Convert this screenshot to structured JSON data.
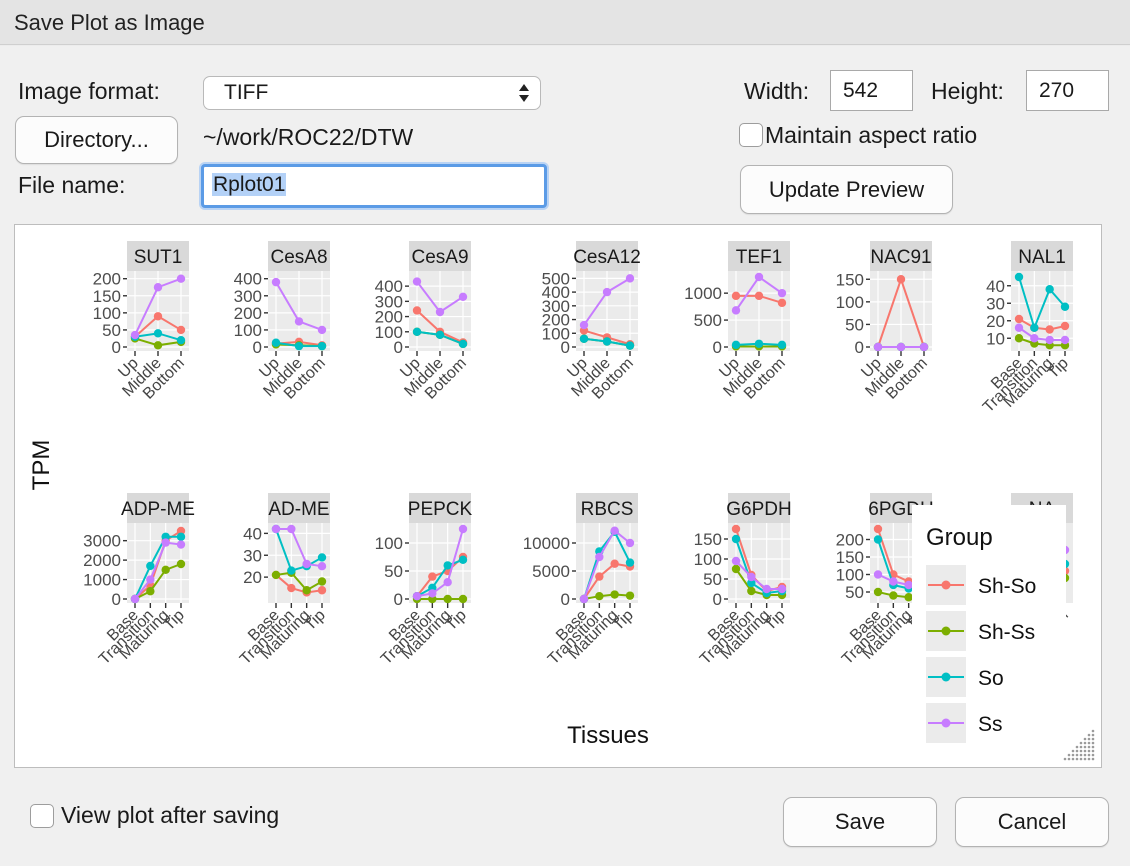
{
  "window": {
    "title": "Save Plot as Image"
  },
  "form": {
    "image_format_label": "Image format:",
    "image_format_value": "TIFF",
    "directory_button": "Directory...",
    "directory_path": "~/work/ROC22/DTW",
    "file_name_label": "File name:",
    "file_name_value": "Rplot01",
    "width_label": "Width:",
    "width_value": "542",
    "height_label": "Height:",
    "height_value": "270",
    "maintain_aspect_label": "Maintain aspect ratio",
    "maintain_aspect_checked": false,
    "update_preview_button": "Update Preview",
    "view_after_saving_label": "View plot after saving",
    "view_after_saving_checked": false,
    "save_button": "Save",
    "cancel_button": "Cancel"
  },
  "chart_data": {
    "type": "line",
    "xlabel": "Tissues",
    "ylabel": "TPM",
    "legend": {
      "title": "Group",
      "position": "right",
      "entries": [
        {
          "name": "Sh-So",
          "color": "#F8766D"
        },
        {
          "name": "Sh-Ss",
          "color": "#7CAE00"
        },
        {
          "name": "So",
          "color": "#00BFC4"
        },
        {
          "name": "Ss",
          "color": "#C77CFF"
        }
      ]
    },
    "panels": [
      {
        "title": "SUT1",
        "x": [
          "Up",
          "Middle",
          "Bottom"
        ],
        "yticks": [
          0,
          50,
          100,
          150,
          200
        ],
        "ylim": [
          0,
          205
        ],
        "series": {
          "Sh-So": [
            30,
            90,
            50
          ],
          "Sh-Ss": [
            25,
            5,
            15
          ],
          "So": [
            30,
            40,
            20
          ],
          "Ss": [
            35,
            175,
            200
          ]
        }
      },
      {
        "title": "CesA8",
        "x": [
          "Up",
          "Middle",
          "Bottom"
        ],
        "yticks": [
          0,
          100,
          200,
          300,
          400
        ],
        "ylim": [
          0,
          410
        ],
        "series": {
          "Sh-So": [
            20,
            30,
            10
          ],
          "Sh-Ss": [
            15,
            10,
            5
          ],
          "So": [
            25,
            5,
            5
          ],
          "Ss": [
            380,
            150,
            100
          ]
        }
      },
      {
        "title": "CesA9",
        "x": [
          "Up",
          "Middle",
          "Bottom"
        ],
        "yticks": [
          0,
          100,
          200,
          300,
          400
        ],
        "ylim": [
          0,
          460
        ],
        "series": {
          "Sh-So": [
            240,
            100,
            30
          ],
          "Sh-Ss": [
            100,
            80,
            20
          ],
          "So": [
            100,
            80,
            20
          ],
          "Ss": [
            430,
            230,
            330
          ]
        }
      },
      {
        "title": "CesA12",
        "x": [
          "Up",
          "Middle",
          "Bottom"
        ],
        "yticks": [
          0,
          100,
          200,
          300,
          400,
          500
        ],
        "ylim": [
          0,
          510
        ],
        "series": {
          "Sh-So": [
            120,
            70,
            20
          ],
          "Sh-Ss": [
            60,
            40,
            10
          ],
          "So": [
            60,
            40,
            10
          ],
          "Ss": [
            160,
            400,
            500
          ]
        }
      },
      {
        "title": "TEF1",
        "x": [
          "Up",
          "Middle",
          "Bottom"
        ],
        "yticks": [
          0,
          500,
          1000
        ],
        "ylim": [
          0,
          1300
        ],
        "series": {
          "Sh-So": [
            950,
            950,
            820
          ],
          "Sh-Ss": [
            10,
            10,
            10
          ],
          "So": [
            40,
            60,
            40
          ],
          "Ss": [
            680,
            1300,
            1000
          ]
        }
      },
      {
        "title": "NAC91",
        "x": [
          "Up",
          "Middle",
          "Bottom"
        ],
        "yticks": [
          0,
          50,
          100,
          150
        ],
        "ylim": [
          0,
          155
        ],
        "series": {
          "Sh-So": [
            0,
            150,
            0
          ],
          "Sh-Ss": [
            0,
            0,
            0
          ],
          "So": [
            0,
            0,
            0
          ],
          "Ss": [
            0,
            0,
            0
          ]
        }
      },
      {
        "title": "NAL1",
        "x": [
          "Base",
          "Transition",
          "Maturing",
          "Tip"
        ],
        "yticks": [
          10,
          20,
          30,
          40
        ],
        "ylim": [
          5,
          45
        ],
        "series": {
          "Sh-So": [
            21,
            16,
            15,
            17
          ],
          "Sh-Ss": [
            10,
            7,
            6,
            6
          ],
          "So": [
            45,
            16,
            38,
            28
          ],
          "Ss": [
            16,
            10,
            9,
            9
          ]
        }
      },
      {
        "title": "ADP-ME",
        "x": [
          "Base",
          "Transition",
          "Maturing",
          "Tip"
        ],
        "yticks": [
          0,
          1000,
          2000,
          3000
        ],
        "ylim": [
          0,
          3600
        ],
        "series": {
          "Sh-So": [
            0,
            700,
            3000,
            3500
          ],
          "Sh-Ss": [
            0,
            400,
            1500,
            1800
          ],
          "So": [
            0,
            1700,
            3200,
            3200
          ],
          "Ss": [
            0,
            1000,
            2900,
            2800
          ]
        }
      },
      {
        "title": "AD-ME",
        "x": [
          "Base",
          "Transition",
          "Maturing",
          "Tip"
        ],
        "yticks": [
          20,
          30,
          40
        ],
        "ylim": [
          10,
          42
        ],
        "series": {
          "Sh-So": [
            21,
            15,
            13,
            14
          ],
          "Sh-Ss": [
            21,
            22,
            14,
            18
          ],
          "So": [
            42,
            23,
            25,
            29
          ],
          "Ss": [
            42,
            42,
            26,
            25
          ]
        }
      },
      {
        "title": "PEPCK",
        "x": [
          "Base",
          "Transition",
          "Maturing",
          "Tip"
        ],
        "yticks": [
          0,
          50,
          100
        ],
        "ylim": [
          0,
          125
        ],
        "series": {
          "Sh-So": [
            5,
            40,
            50,
            75
          ],
          "Sh-Ss": [
            0,
            0,
            0,
            0
          ],
          "So": [
            5,
            20,
            60,
            70
          ],
          "Ss": [
            5,
            10,
            30,
            125
          ]
        }
      },
      {
        "title": "RBCS",
        "x": [
          "Base",
          "Transition",
          "Maturing",
          "Tip"
        ],
        "yticks": [
          0,
          5000,
          10000
        ],
        "ylim": [
          0,
          12500
        ],
        "series": {
          "Sh-So": [
            0,
            4000,
            6300,
            5800
          ],
          "Sh-Ss": [
            0,
            500,
            800,
            600
          ],
          "So": [
            0,
            8500,
            12000,
            6500
          ],
          "Ss": [
            0,
            7500,
            12200,
            10000
          ]
        }
      },
      {
        "title": "G6PDH",
        "x": [
          "Base",
          "Transition",
          "Maturing",
          "Tip"
        ],
        "yticks": [
          0,
          50,
          100,
          150
        ],
        "ylim": [
          0,
          175
        ],
        "series": {
          "Sh-So": [
            175,
            60,
            20,
            30
          ],
          "Sh-Ss": [
            75,
            20,
            10,
            10
          ],
          "So": [
            150,
            40,
            15,
            20
          ],
          "Ss": [
            95,
            55,
            25,
            25
          ]
        }
      },
      {
        "title": "6PGDH",
        "x": [
          "Base",
          "Transition",
          "Maturing",
          "Tip"
        ],
        "yticks": [
          50,
          100,
          150,
          200
        ],
        "ylim": [
          30,
          230
        ],
        "series": {
          "Sh-So": [
            230,
            100,
            80,
            70
          ],
          "Sh-Ss": [
            50,
            40,
            35,
            30
          ],
          "So": [
            200,
            70,
            60,
            50
          ],
          "Ss": [
            100,
            80,
            70,
            60
          ]
        }
      },
      {
        "title": "NA",
        "x": [
          "Up",
          "Middle",
          "Bottom"
        ],
        "yticks": [],
        "ylim": [
          0,
          10
        ],
        "series": {
          "Sh-So": [
            6,
            5,
            4
          ],
          "Sh-Ss": [
            5,
            4,
            3
          ],
          "So": [
            6,
            5,
            5
          ],
          "Ss": [
            8,
            7,
            7
          ]
        }
      }
    ]
  }
}
